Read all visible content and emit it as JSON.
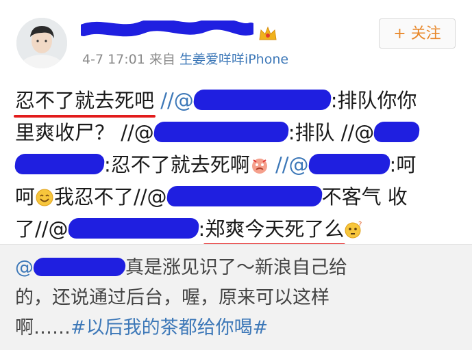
{
  "header": {
    "meta_time": "4-7 17:01",
    "meta_from": "来自",
    "meta_source": "生姜爱咩咩iPhone",
    "follow_label": "+ 关注"
  },
  "post": {
    "l1_text": "忍不了就去死吧",
    "l1_sep": " //@",
    "l1_after": ":排队你你",
    "l2_text": "里爽收尸？ //@",
    "l2_after": ":排队 //@",
    "l3_after": ":忍不了就去死啊",
    "l3_sep": " //@",
    "l3_tail": ":呵",
    "l4_text": "呵",
    "l4_mid": "我忍不了//@",
    "l4_after": "不客气 收",
    "l5_text": "了//@",
    "l5_after": ":",
    "l5_highlight": "郑爽今天死了么"
  },
  "repost": {
    "l1_at": "@",
    "l1_text": "真是涨见识了～新浪自己给",
    "l2_text": "的，还说通过后台，喔，原来可以这样",
    "l3_text": "啊……",
    "topic": "#以后我的茶都给你喝#"
  },
  "colors": {
    "link": "#3d78b8",
    "redaction": "#1f1fe0",
    "underline": "#e21b1b",
    "follow": "#e8882b"
  }
}
